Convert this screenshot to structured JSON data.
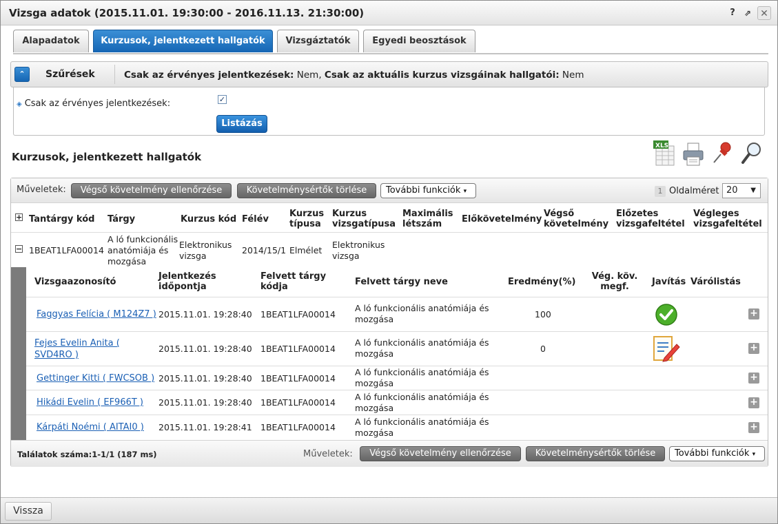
{
  "window": {
    "title": "Vizsga adatok (2015.11.01. 19:30:00 - 2016.11.13. 21:30:00)",
    "help_label": "?",
    "popout_label": "⇗",
    "close_label": "✕"
  },
  "tabs": [
    {
      "label": "Alapadatok"
    },
    {
      "label": "Kurzusok, jelentkezett hallgatók"
    },
    {
      "label": "Vizsgáztatók"
    },
    {
      "label": "Egyedi beosztások"
    }
  ],
  "filters": {
    "title": "Szűrések",
    "summary_label_1": "Csak az érvényes jelentkezések:",
    "summary_value_1": " Nem, ",
    "summary_label_2": "Csak az aktuális kurzus vizsgáinak hallgatói:",
    "summary_value_2": " Nem",
    "field_label": "Csak az érvényes jelentkezések:",
    "checkbox_mark": "✓",
    "list_button": "Listázás"
  },
  "section": {
    "title": "Kurzusok, jelentkezett hallgatók",
    "icons": [
      "xls-export-icon",
      "print-icon",
      "pin-icon",
      "search-icon"
    ],
    "xls_label": "XLS"
  },
  "grid": {
    "ops_label": "Műveletek:",
    "btn_check": "Végső követelmény ellenőrzése",
    "btn_delete": "Követelménysértők törlése",
    "btn_more": "További funkciók",
    "page_number": "1",
    "page_size_label": "Oldalméret",
    "page_size": "20",
    "columns": {
      "code": "Tantárgy kód",
      "subject": "Tárgy",
      "course_code": "Kurzus kód",
      "semester": "Félév",
      "course_type_1": "Kurzus",
      "course_type_2": "típusa",
      "exam_type_1": "Kurzus",
      "exam_type_2": "vizsgatípusa",
      "max_1": "Maximális",
      "max_2": "létszám",
      "prereq": "Előkövetelmény",
      "final_req_1": "Végső",
      "final_req_2": "követelmény",
      "pre_cond_1": "Előzetes",
      "pre_cond_2": "vizsgafeltétel",
      "final_cond_1": "Végleges",
      "final_cond_2": "vizsgafeltétel"
    },
    "course_row": {
      "code": "1BEAT1LFA00014",
      "subject_1": "A ló funkcionális",
      "subject_2": "anatómiája és",
      "subject_3": "mozgása",
      "course_code_1": "Elektronikus",
      "course_code_2": "vizsga",
      "semester": "2014/15/1",
      "course_type": "Elmélet",
      "exam_type_1": "Elektronikus",
      "exam_type_2": "vizsga"
    },
    "sub_columns": {
      "id": "Vizsgaazonosító",
      "signup_1": "Jelentkezés",
      "signup_2": "időpontja",
      "taken_code_1": "Felvett tárgy",
      "taken_code_2": "kódja",
      "taken_name": "Felvett tárgy neve",
      "result": "Eredmény(%)",
      "final_ok_1": "Vég. köv.",
      "final_ok_2": "megf.",
      "fix": "Javítás",
      "waitlist": "Várólistás"
    },
    "students": [
      {
        "name": "Faggyas Felícia ( M124Z7 )",
        "name_2": "",
        "time": "2015.11.01. 19:28:40",
        "code": "1BEAT1LFA00014",
        "subject_1": "A ló funkcionális anatómiája és",
        "subject_2": "mozgása",
        "result": "100",
        "icon": "check-icon"
      },
      {
        "name": "Fejes Evelin Anita (",
        "name_2": "SVD4RO )",
        "time": "2015.11.01. 19:28:40",
        "code": "1BEAT1LFA00014",
        "subject_1": "A ló funkcionális anatómiája és",
        "subject_2": "mozgása",
        "result": "0",
        "icon": "edit-icon"
      },
      {
        "name": "Gettinger Kitti ( FWCSOB )",
        "name_2": "",
        "time": "2015.11.01. 19:28:40",
        "code": "1BEAT1LFA00014",
        "subject_1": "A ló funkcionális anatómiája és",
        "subject_2": "mozgása",
        "result": "",
        "icon": ""
      },
      {
        "name": "Hikádi Evelin ( EF966T )",
        "name_2": "",
        "time": "2015.11.01. 19:28:40",
        "code": "1BEAT1LFA00014",
        "subject_1": "A ló funkcionális anatómiája és",
        "subject_2": "mozgása",
        "result": "",
        "icon": ""
      },
      {
        "name": "Kárpáti Noémi ( AITAI0 )",
        "name_2": "",
        "time": "2015.11.01. 19:28:41",
        "code": "1BEAT1LFA00014",
        "subject_1": "A ló funkcionális anatómiája és",
        "subject_2": "mozgása",
        "result": "",
        "icon": ""
      }
    ],
    "footer_count": "Találatok száma:1-1/1 (187 ms)",
    "footer_ops_label": "Műveletek:"
  },
  "bottom": {
    "back_label": "Vissza"
  },
  "colors": {
    "accent": "#1566b4",
    "link": "#1a5fb4",
    "gray_button": "#777777"
  }
}
